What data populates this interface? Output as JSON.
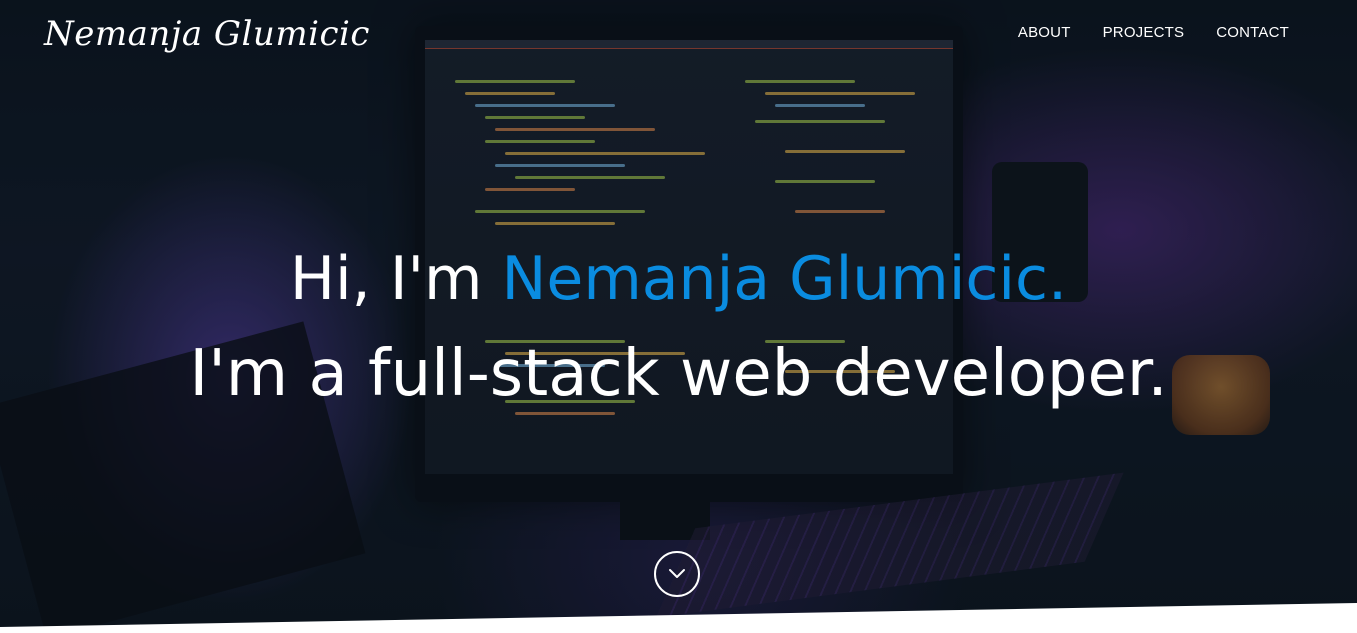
{
  "header": {
    "logo": "Nemanja Glumicic",
    "nav": [
      {
        "label": "ABOUT"
      },
      {
        "label": "PROJECTS"
      },
      {
        "label": "CONTACT"
      }
    ]
  },
  "hero": {
    "greeting_prefix": "Hi, I'm ",
    "name": "Nemanja Glumicic.",
    "tagline": "I'm a full-stack web developer.",
    "scroll_icon": "chevron-down-icon"
  },
  "colors": {
    "accent": "#0a8ce0",
    "text": "#ffffff",
    "background": "#0d1520"
  }
}
